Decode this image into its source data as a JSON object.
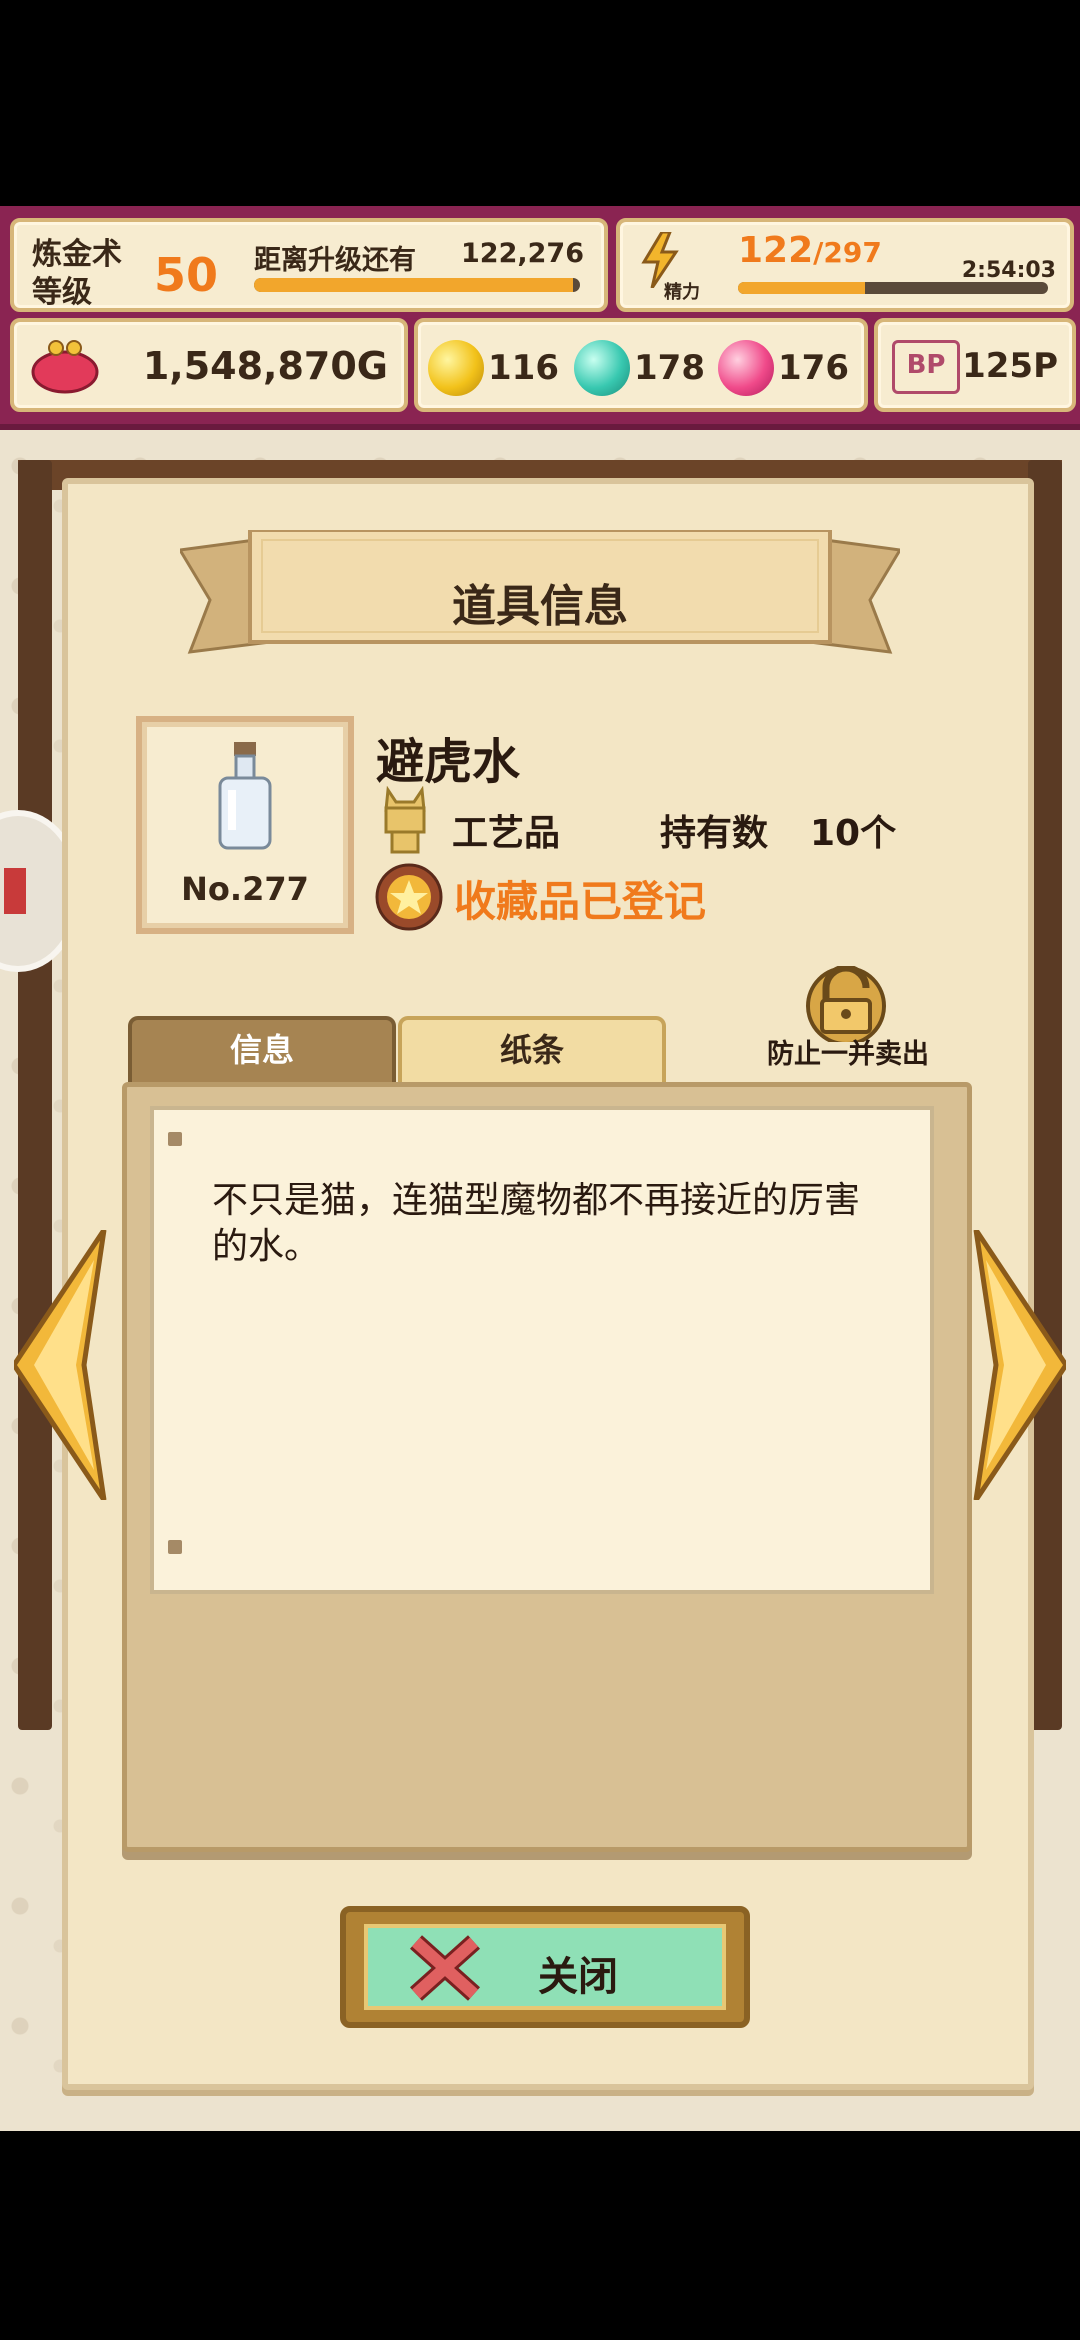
{
  "hud": {
    "level_label": "炼金术\n等级",
    "level_value": "50",
    "exp_label": "距离升级还有",
    "exp_value": "122,276",
    "exp_progress": 0.98,
    "stamina_current": "122",
    "stamina_max": "/297",
    "stamina_caption": "精力",
    "stamina_time": "2:54:03",
    "stamina_progress": 0.41,
    "gold": "1,548,870G",
    "orb_yellow": "116",
    "orb_teal": "178",
    "orb_pink": "176",
    "bp_icon_label": "BP",
    "bp_value": "125P",
    "colors": {
      "hud_bg": "#8a2452",
      "accent_orange": "#f07a1c"
    }
  },
  "panel": {
    "title": "道具信息",
    "item": {
      "number": "No.277",
      "name": "避虎水",
      "category": "工艺品",
      "owned_label": "持有数",
      "owned_value": "10个",
      "collection_status": "收藏品已登记"
    },
    "tabs": {
      "info": "信息",
      "note": "纸条"
    },
    "lock_label": "防止一并卖出",
    "note_text": "不只是猫，连猫型魔物都不再接近的厉害的水。",
    "close_label": "关闭"
  },
  "icons": [
    "purse-icon",
    "lightning-icon",
    "yellow-orb-icon",
    "teal-orb-icon",
    "pink-orb-icon",
    "bp-ticket-icon",
    "bottle-icon",
    "cat-statue-icon",
    "star-medal-icon",
    "padlock-icon",
    "left-arrow-icon",
    "right-arrow-icon",
    "close-x-icon"
  ]
}
